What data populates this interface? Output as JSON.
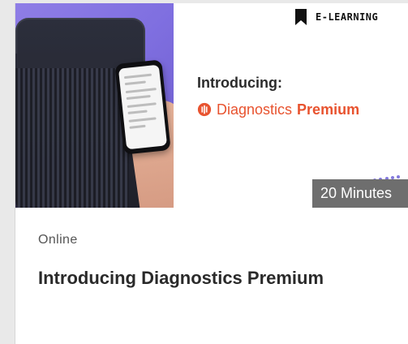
{
  "course_card": {
    "badge": {
      "label": "E-LEARNING",
      "icon": "bookmark-icon"
    },
    "hero": {
      "intro": "Introducing:",
      "brand": {
        "icon": "diagnostics-logo-icon",
        "name": "Diagnostics",
        "tier": "Premium"
      }
    },
    "duration": "20 Minutes",
    "delivery": "Online",
    "title": "Introducing Diagnostics Premium"
  },
  "colors": {
    "accent_orange": "#e8532f",
    "badge_text": "#111111",
    "duration_bg": "#6e6e6e",
    "hero_photo_purple": "#7f6fe0"
  }
}
